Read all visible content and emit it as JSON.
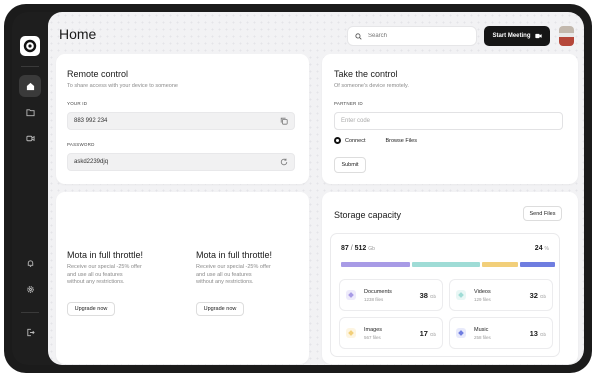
{
  "header": {
    "title": "Home",
    "search_placeholder": "Search",
    "start_meeting_label": "Start Meeting"
  },
  "remote_control": {
    "title": "Remote control",
    "subtitle": "To share access with your device to someone",
    "id_label": "YOUR ID",
    "id_value": "883 992 234",
    "password_label": "PASSWORD",
    "password_value": "askd2239djq"
  },
  "take_control": {
    "title": "Take the control",
    "subtitle": "Of someone's device remotely.",
    "partner_label": "PARTNER ID",
    "partner_placeholder": "Enter code",
    "options": [
      "Connect",
      "Browse Files"
    ],
    "selected_option": "Connect",
    "submit_label": "Submit"
  },
  "promos": [
    {
      "title": "Mota in full throttle!",
      "text_lines": [
        "Receive our special -25% offer",
        "and use all ou features",
        "without any restrictions."
      ],
      "button_label": "Upgrade now"
    },
    {
      "title": "Mota in full throttle!",
      "text_lines": [
        "Receive our special -25% offer",
        "and use all ou features",
        "without any restrictions."
      ],
      "button_label": "Upgrade now"
    }
  ],
  "storage": {
    "title": "Storage capacity",
    "send_files_label": "Send Files",
    "used": "87",
    "total": "512",
    "unit": "Gb",
    "percent": "24",
    "percent_unit": "%",
    "bar_segments": [
      {
        "color": "#a89be6",
        "fraction": 0.33
      },
      {
        "color": "#9fdcd6",
        "fraction": 0.33
      },
      {
        "color": "#f2cf7a",
        "fraction": 0.17
      },
      {
        "color": "#6f7de0",
        "fraction": 0.17
      }
    ],
    "categories": [
      {
        "name": "Documents",
        "count": "1238 files",
        "size": "38",
        "unit": "Gb",
        "color": "#a89be6",
        "bg": "#eeebfb"
      },
      {
        "name": "Videos",
        "count": "129 files",
        "size": "32",
        "unit": "Gb",
        "color": "#9fdcd6",
        "bg": "#e9f7f5"
      },
      {
        "name": "Images",
        "count": "567 files",
        "size": "17",
        "unit": "Gb",
        "color": "#f2cf7a",
        "bg": "#fdf5e2"
      },
      {
        "name": "Music",
        "count": "258 files",
        "size": "13",
        "unit": "Gb",
        "color": "#6f7de0",
        "bg": "#e8eafb"
      }
    ]
  }
}
